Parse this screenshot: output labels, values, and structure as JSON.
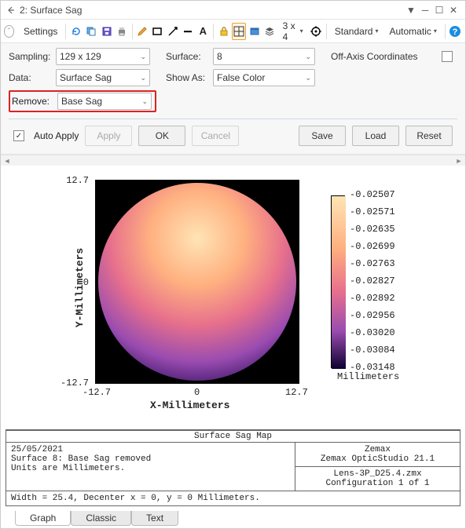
{
  "window": {
    "title": "2: Surface Sag"
  },
  "toolbar": {
    "settings_label": "Settings",
    "grid_label": "3 x 4",
    "std_label": "Standard",
    "auto_label": "Automatic"
  },
  "form": {
    "sampling_label": "Sampling:",
    "sampling_value": "129 x 129",
    "data_label": "Data:",
    "data_value": "Surface Sag",
    "remove_label": "Remove:",
    "remove_value": "Base Sag",
    "surface_label": "Surface:",
    "surface_value": "8",
    "showas_label": "Show As:",
    "showas_value": "False Color",
    "offaxis_label": "Off-Axis Coordinates"
  },
  "buttons": {
    "auto_apply": "Auto Apply",
    "apply": "Apply",
    "ok": "OK",
    "cancel": "Cancel",
    "save": "Save",
    "load": "Load",
    "reset": "Reset"
  },
  "chart_data": {
    "type": "heatmap",
    "xlabel": "X-Millimeters",
    "ylabel": "Y-Millimeters",
    "xlim": [
      -12.7,
      12.7
    ],
    "ylim": [
      -12.7,
      12.7
    ],
    "xticks": [
      -12.7,
      0,
      12.7
    ],
    "yticks": [
      -12.7,
      0,
      12.7
    ],
    "colorbar_unit": "Millimeters",
    "colorbar_ticks": [
      -0.02507,
      -0.02571,
      -0.02635,
      -0.02699,
      -0.02763,
      -0.02827,
      -0.02892,
      -0.02956,
      -0.0302,
      -0.03084,
      -0.03148
    ],
    "shape": "disk",
    "radius_mm": 12.7,
    "value_range": [
      -0.03148,
      -0.02507
    ],
    "gradient_direction": "top-to-bottom",
    "description": "Surface sag map (Base Sag removed) for surface 8; values sampled on a 129x129 grid over a 25.4 mm diameter aperture. Sag varies smoothly from approx -0.02507 mm at the top edge to -0.03148 mm at the bottom edge."
  },
  "info": {
    "title": "Surface Sag Map",
    "date": "25/05/2021",
    "line1": "Surface 8: Base Sag removed",
    "line2": "Units are Millimeters.",
    "line3": "Width = 25.4, Decenter x = 0, y = 0 Millimeters.",
    "brand": "Zemax",
    "product": "Zemax OpticStudio 21.1",
    "file": "Lens-3P_D25.4.zmx",
    "config": "Configuration 1 of 1"
  },
  "tabs": {
    "graph": "Graph",
    "classic": "Classic",
    "text": "Text"
  }
}
